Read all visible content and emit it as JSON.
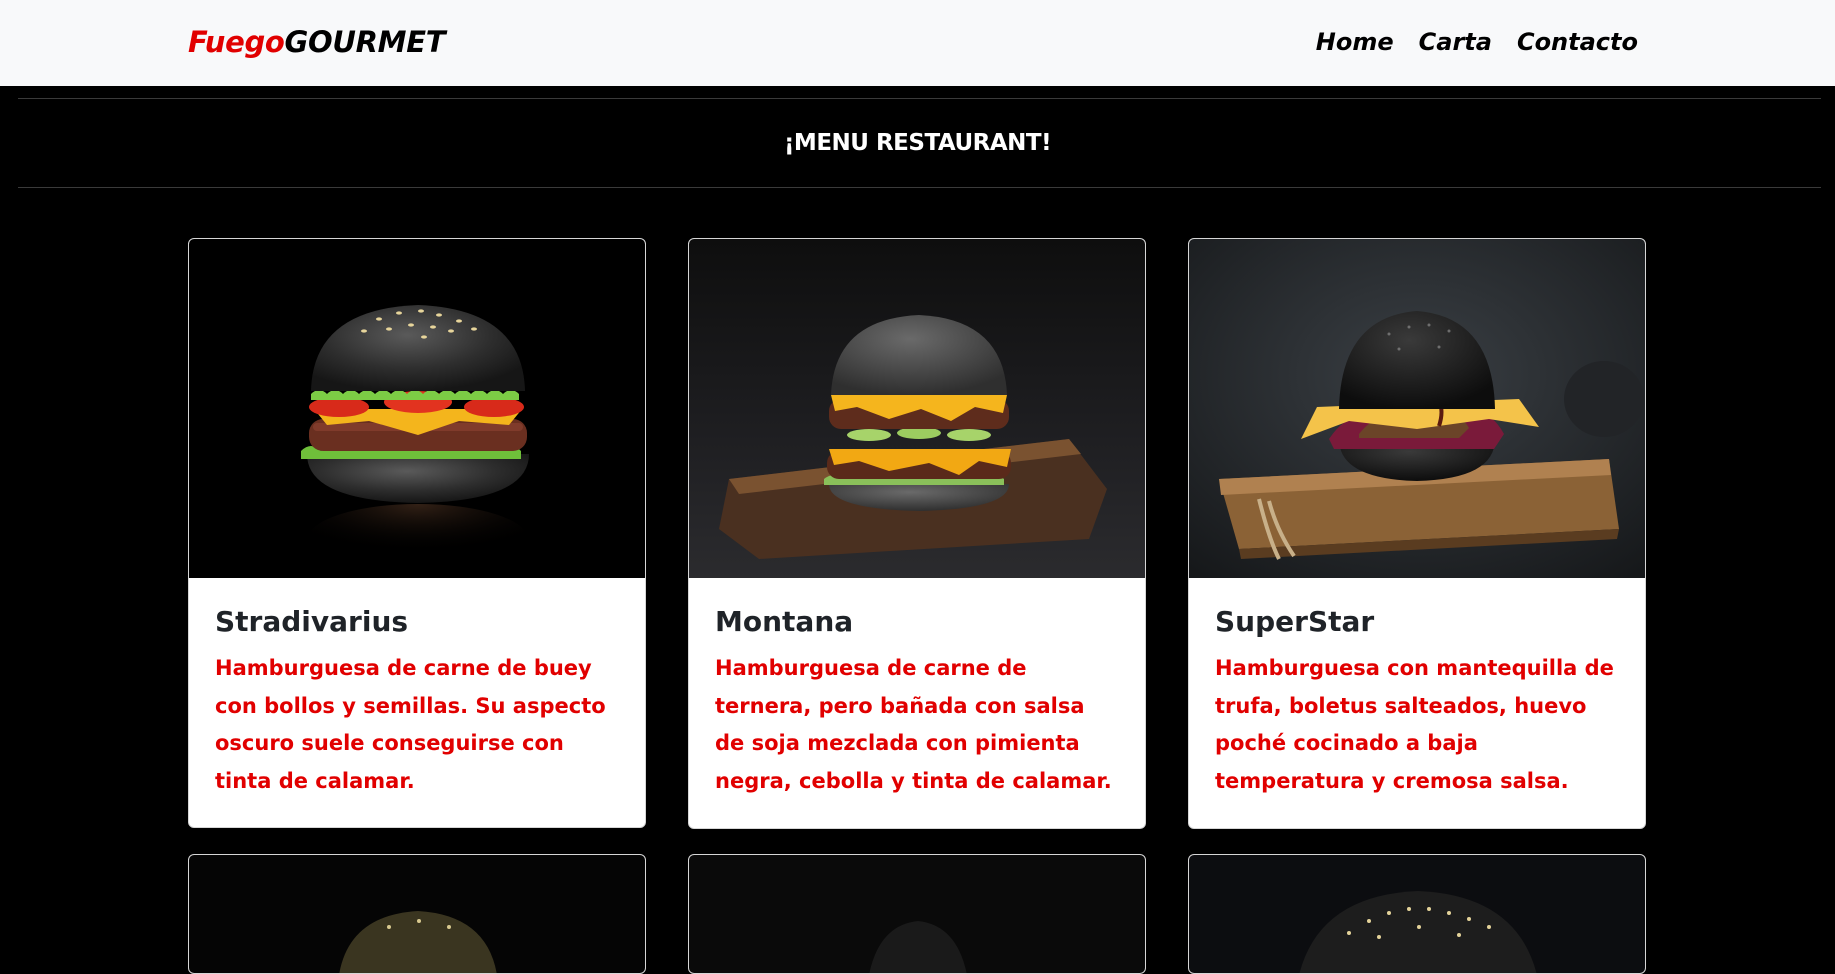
{
  "navbar": {
    "brand_part1": "Fuego",
    "brand_part2": "GOURMET",
    "links": [
      "Home",
      "Carta",
      "Contacto"
    ]
  },
  "header": {
    "title": "¡MENU RESTAURANT!"
  },
  "cards": [
    {
      "name": "Stradivarius",
      "description": "Hamburguesa de carne de buey con bollos y semillas. Su aspecto oscuro suele conseguirse con tinta de calamar."
    },
    {
      "name": "Montana",
      "description": "Hamburguesa de carne de ternera, pero bañada con salsa de soja mezclada con pimienta negra, cebolla y tinta de calamar."
    },
    {
      "name": "SuperStar",
      "description": "Hamburguesa con mantequilla de trufa, boletus salteados, huevo poché cocinado a baja temperatura y cremosa salsa."
    }
  ],
  "colors": {
    "accent_red": "#e10000",
    "navbar_bg": "#f8f9fa",
    "page_bg": "#000000"
  }
}
